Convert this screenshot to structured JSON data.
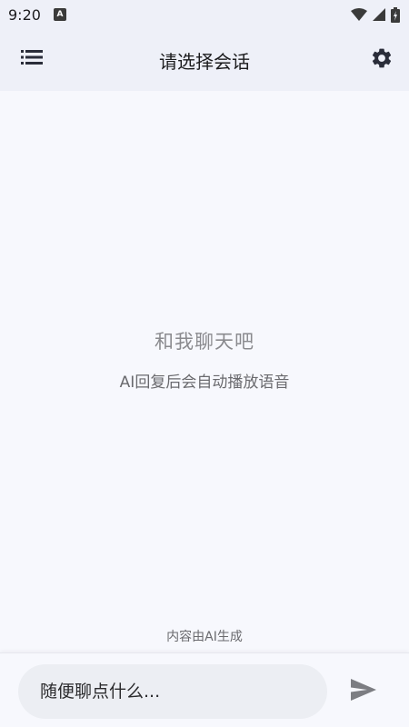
{
  "status_bar": {
    "time": "9:20",
    "app_icon_letter": "A",
    "icons": [
      "wifi-icon",
      "cellular-signal-icon",
      "battery-charging-icon"
    ]
  },
  "app_bar": {
    "title": "请选择会话",
    "left_icon": "menu-list-icon",
    "right_icon": "gear-icon"
  },
  "empty_state": {
    "title": "和我聊天吧",
    "subtitle": "AI回复后会自动播放语音"
  },
  "footer_note": "内容由AI生成",
  "composer": {
    "placeholder": "随便聊点什么...",
    "value": "",
    "send_icon": "send-icon"
  },
  "colors": {
    "background": "#f7f8fd",
    "header": "#eef0f8",
    "input_bg": "#eceef3",
    "muted_text": "#8a8a8e"
  }
}
